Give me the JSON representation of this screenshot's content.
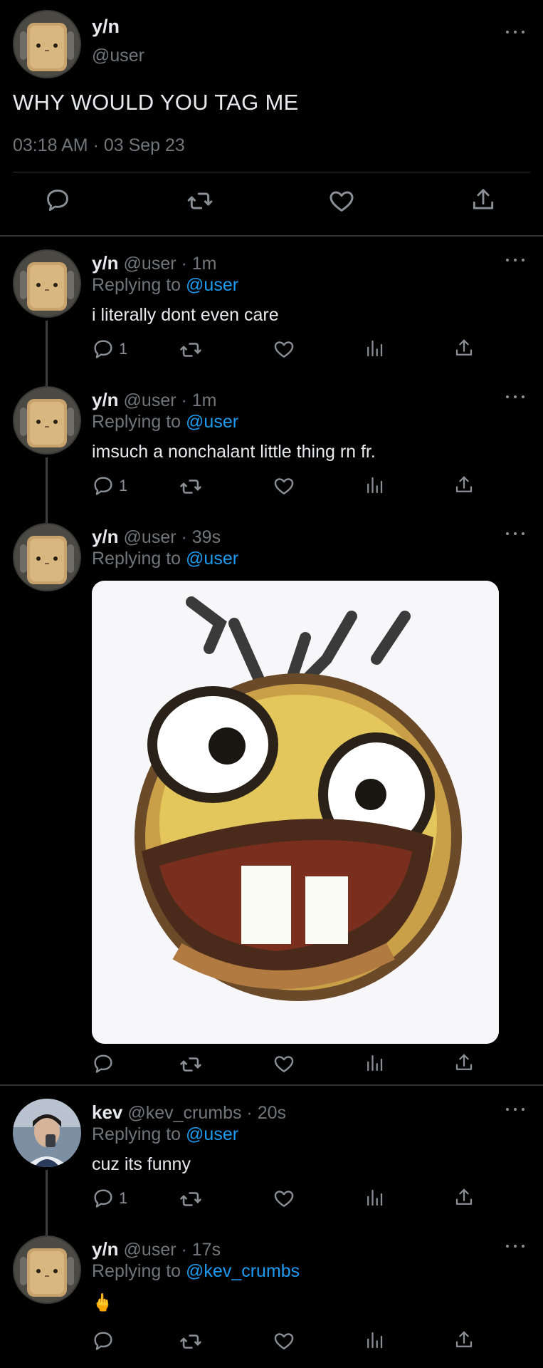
{
  "main_tweet": {
    "name": "y/n",
    "handle": "@user",
    "text": "WHY WOULD YOU TAG ME",
    "timestamp": "03:18 AM · 03 Sep 23"
  },
  "replies": [
    {
      "name": "y/n",
      "meta": "@user · 1m",
      "replying_prefix": "Replying to",
      "replying_to": "@user",
      "text": "i literally dont even care",
      "reply_count": "1"
    },
    {
      "name": "y/n",
      "meta": "@user · 1m",
      "replying_prefix": "Replying to",
      "replying_to": "@user",
      "text": "imsuch a nonchalant little thing rn fr.",
      "reply_count": "1"
    },
    {
      "name": "y/n",
      "meta": "@user · 39s",
      "replying_prefix": "Replying to",
      "replying_to": "@user",
      "text": "",
      "has_media": true
    },
    {
      "name": "kev",
      "meta": "@kev_crumbs · 20s",
      "replying_prefix": "Replying to",
      "replying_to": "@user",
      "text": "cuz its funny",
      "reply_count": "1"
    },
    {
      "name": "y/n",
      "meta": "@user · 17s",
      "replying_prefix": "Replying to",
      "replying_to": "@kev_crumbs",
      "text": "🖕"
    }
  ],
  "colors": {
    "background": "#000000",
    "text": "#e7e9ea",
    "muted": "#71767b",
    "link": "#1d9bf0",
    "divider": "#2f3336"
  },
  "icons": [
    "reply-icon",
    "retweet-icon",
    "like-icon",
    "views-icon",
    "share-icon",
    "more-icon"
  ]
}
